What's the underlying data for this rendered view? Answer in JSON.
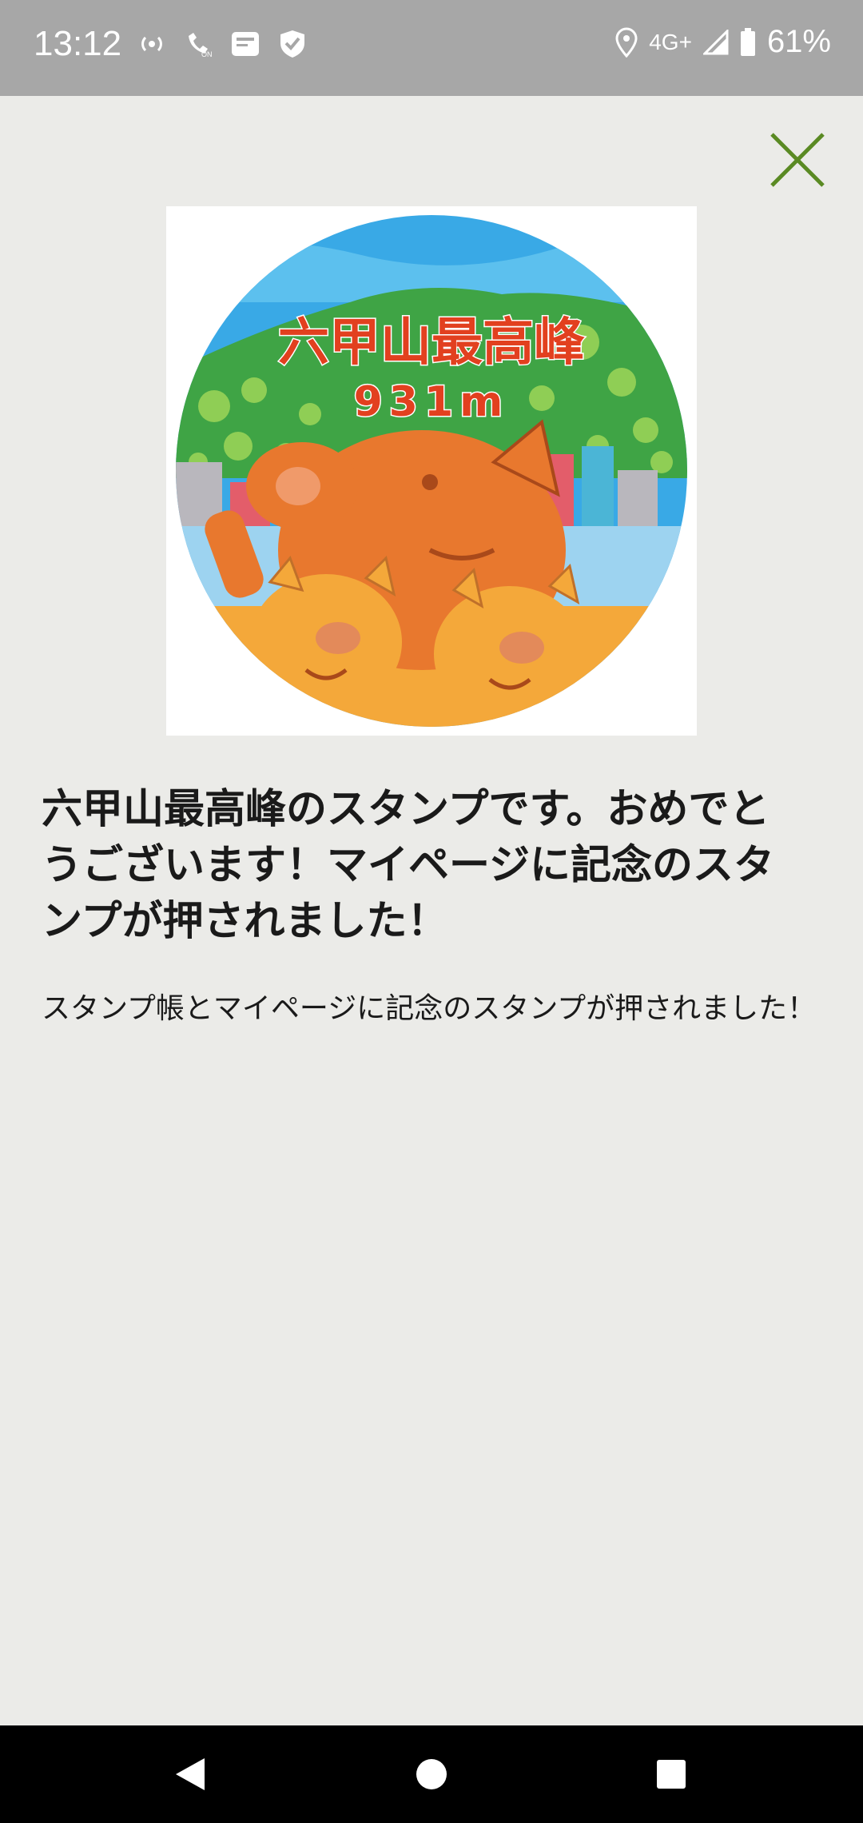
{
  "status_bar": {
    "time": "13:12",
    "network": "4G+",
    "battery": "61%",
    "icons_left": [
      "broadcast-icon",
      "wifi-calling-icon",
      "sim-card-icon",
      "shield-check-icon"
    ],
    "icons_right": [
      "location-pin-icon",
      "signal-icon",
      "battery-icon"
    ]
  },
  "stamp": {
    "title": "六甲山最高峰",
    "elevation": "931m",
    "colors": {
      "sky": "#39a9e6",
      "mountain": "#3fa445",
      "boar": "#e8782e",
      "piglet": "#f4a83a",
      "water": "#9dd3f0",
      "text": "#e2401f"
    }
  },
  "heading": "六甲山最高峰のスタンプです。おめでとうございます！マイページに記念のスタンプが押されました！",
  "body": "スタンプ帳とマイページに記念のスタンプが押されました！",
  "close_color": "#5a8a23",
  "nav": {
    "icons": [
      "back-icon",
      "home-icon",
      "recents-icon"
    ]
  }
}
